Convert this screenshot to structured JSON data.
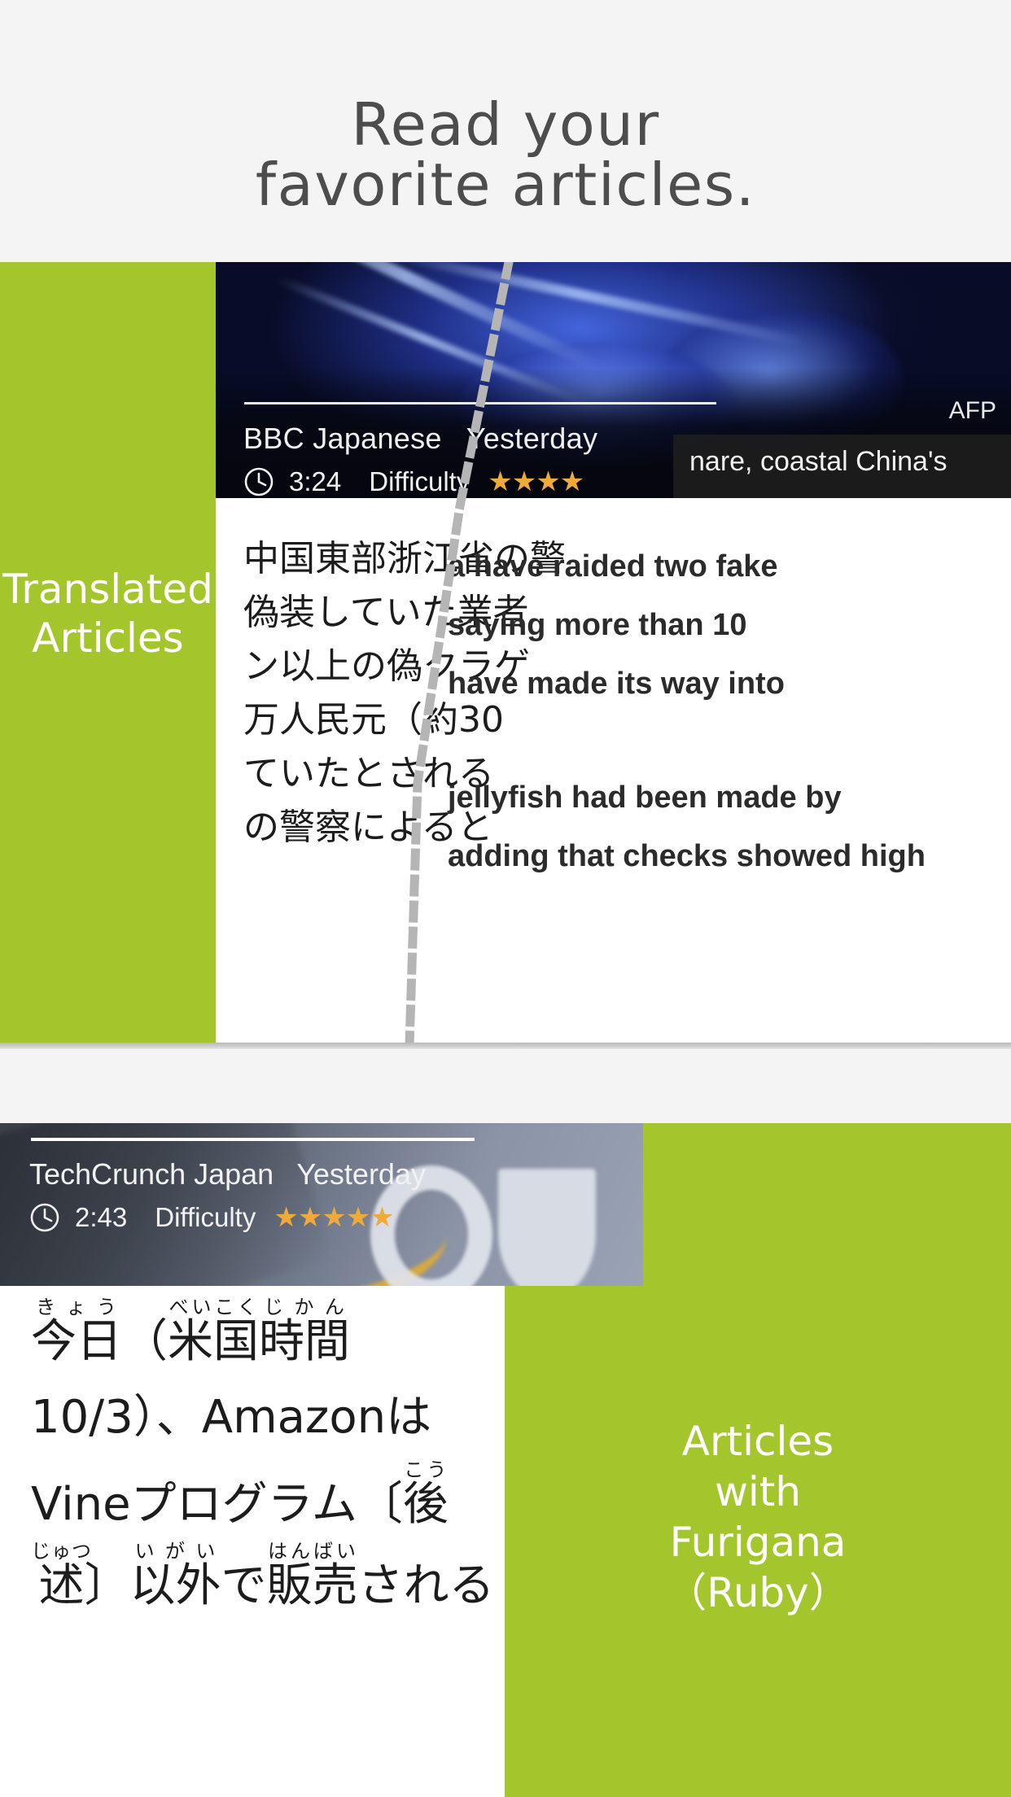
{
  "headline": {
    "line1": "Read your",
    "line2": "favorite articles."
  },
  "sections": [
    {
      "label": "Translated\nArticles",
      "label_line1": "Translated",
      "label_line2": "Articles",
      "accent_color": "#a3c62d",
      "card": {
        "source": "BBC Japanese",
        "date": "Yesterday",
        "duration": "3:24",
        "difficulty_label": "Difficulty",
        "difficulty_stars": "★★★★",
        "difficulty_value": 4,
        "photo_credit": "AFP",
        "clock_icon": "clock-icon",
        "headline_overlay_en": "nare, coastal China's",
        "body_jp": [
          "中国東部浙江省の警",
          "偽装していた業者",
          "ン以上の偽クラゲ",
          "万人民元（約30",
          "ていたとされる",
          "の警察によると"
        ],
        "body_en": [
          "a have raided two fake",
          "saying more than 10",
          "have made its way into",
          "jellyfish had been made by",
          "adding that checks showed high"
        ]
      }
    },
    {
      "label_line1": "Articles",
      "label_line2": "with",
      "label_line3": "Furigana",
      "label_line4": "（Ruby）",
      "accent_color": "#a3c62d",
      "card": {
        "source": "TechCrunch Japan",
        "date": "Yesterday",
        "duration": "2:43",
        "difficulty_label": "Difficulty",
        "difficulty_stars": "★★★★★",
        "difficulty_value": 5,
        "clock_icon": "clock-icon",
        "body_ruby": [
          [
            {
              "base": "今日",
              "ruby": "きょう"
            },
            {
              "base": "（"
            },
            {
              "base": "米国",
              "ruby": "べいこく"
            },
            {
              "base": "時間",
              "ruby": "じかん"
            }
          ],
          [
            {
              "base": "10/3）、Amazonは"
            }
          ],
          [
            {
              "base": "Vineプログラム〔"
            },
            {
              "base": "後",
              "ruby": "こう"
            }
          ],
          [
            {
              "base": "述",
              "ruby": "じゅつ"
            },
            {
              "base": "〕"
            },
            {
              "base": "以外",
              "ruby": "いがい"
            },
            {
              "base": "で"
            },
            {
              "base": "販売",
              "ruby": "はんばい"
            },
            {
              "base": "される"
            }
          ]
        ]
      }
    }
  ],
  "colors": {
    "background": "#f4f4f4",
    "accent_green": "#a3c62d",
    "star_gold": "#f2a93b",
    "headline_text": "#4d4d4d"
  }
}
